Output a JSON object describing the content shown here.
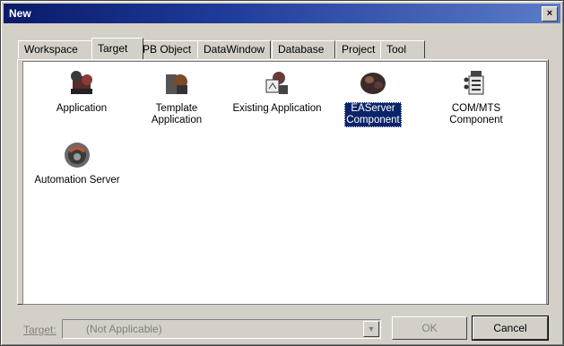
{
  "window": {
    "title": "New",
    "close_label": "×"
  },
  "tabs": [
    {
      "label": "Workspace"
    },
    {
      "label": "Target"
    },
    {
      "label": "PB Object"
    },
    {
      "label": "DataWindow"
    },
    {
      "label": "Database"
    },
    {
      "label": "Project"
    },
    {
      "label": "Tool"
    }
  ],
  "active_tab": "Target",
  "items": [
    {
      "label": "Application",
      "icon": "application-icon"
    },
    {
      "label": "Template\nApplication",
      "icon": "template-application-icon"
    },
    {
      "label": "Existing Application",
      "icon": "existing-application-icon"
    },
    {
      "label": "EAServer\nComponent",
      "icon": "easerver-component-icon",
      "selected": true
    },
    {
      "label": "COM/MTS\nComponent",
      "icon": "com-mts-component-icon"
    },
    {
      "label": "Automation Server",
      "icon": "automation-server-icon"
    }
  ],
  "footer": {
    "target_label": "Target:",
    "target_value": "(Not Applicable)",
    "ok_label": "OK",
    "cancel_label": "Cancel"
  }
}
